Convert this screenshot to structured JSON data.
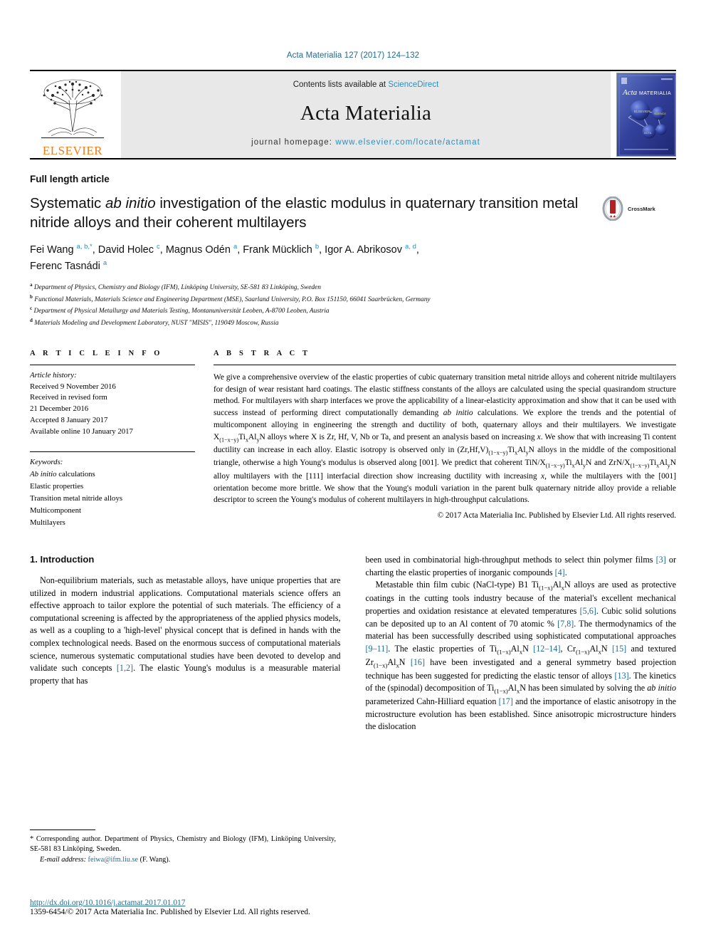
{
  "running_head": "Acta Materialia 127 (2017) 124–132",
  "banner": {
    "publisher_logo_text": "ELSEVIER",
    "contents_prefix": "Contents lists available at ",
    "contents_link": "ScienceDirect",
    "journal_name": "Acta Materialia",
    "homepage_prefix": "journal homepage: ",
    "homepage_url": "www.elsevier.com/locate/actamat",
    "cover_title_top": "Acta",
    "cover_title_bottom": "MATERIALIA"
  },
  "article": {
    "type": "Full length article",
    "title_part1": "Systematic ",
    "title_italic": "ab initio",
    "title_part2": " investigation of the elastic modulus in quaternary transition metal nitride alloys and their coherent multilayers",
    "crossmark_label": "CrossMark",
    "authors_html": "Fei Wang <sup>a, b,</sup><sup>*</sup>, David Holec <sup>c</sup>, Magnus Odén <sup>a</sup>, Frank Mücklich <sup>b</sup>, Igor A. Abrikosov <sup>a, d</sup>, Ferenc Tasnádi <sup>a</sup>",
    "affiliations": [
      {
        "marker": "a",
        "text": "Department of Physics, Chemistry and Biology (IFM), Linköping University, SE-581 83 Linköping, Sweden"
      },
      {
        "marker": "b",
        "text": "Functional Materials, Materials Science and Engineering Department (MSE), Saarland University, P.O. Box 151150, 66041 Saarbrücken, Germany"
      },
      {
        "marker": "c",
        "text": "Department of Physical Metallurgy and Materials Testing, Montanuniversität Leoben, A-8700 Leoben, Austria"
      },
      {
        "marker": "d",
        "text": "Materials Modeling and Development Laboratory, NUST \"MISIS\", 119049 Moscow, Russia"
      }
    ]
  },
  "article_info": {
    "heading": "A R T I C L E  I N F O",
    "history_label": "Article history:",
    "history_lines": [
      "Received 9 November 2016",
      "Received in revised form",
      "21 December 2016",
      "Accepted 8 January 2017",
      "Available online 10 January 2017"
    ],
    "keywords_label": "Keywords:",
    "keywords": [
      "Ab initio calculations",
      "Elastic properties",
      "Transition metal nitride alloys",
      "Multicomponent",
      "Multilayers"
    ]
  },
  "abstract": {
    "heading": "A B S T R A C T",
    "copyright": "© 2017 Acta Materialia Inc. Published by Elsevier Ltd. All rights reserved."
  },
  "introduction": {
    "heading": "1. Introduction"
  },
  "footnote": {
    "corresponding": "* Corresponding author. Department of Physics, Chemistry and Biology (IFM), Linköping University, SE-581 83 Linköping, Sweden.",
    "email_label": "E-mail address:",
    "email": "feiwa@ifm.liu.se",
    "email_suffix": "(F. Wang)."
  },
  "footer": {
    "doi": "http://dx.doi.org/10.1016/j.actamat.2017.01.017",
    "issn_line": "1359-6454/© 2017 Acta Materialia Inc. Published by Elsevier Ltd. All rights reserved."
  },
  "colors": {
    "link_blue": "#1d6a96",
    "sciencedirect_blue": "#2a8fc4",
    "elsevier_orange": "#f07d1a",
    "banner_grey": "#e8e8e8"
  }
}
